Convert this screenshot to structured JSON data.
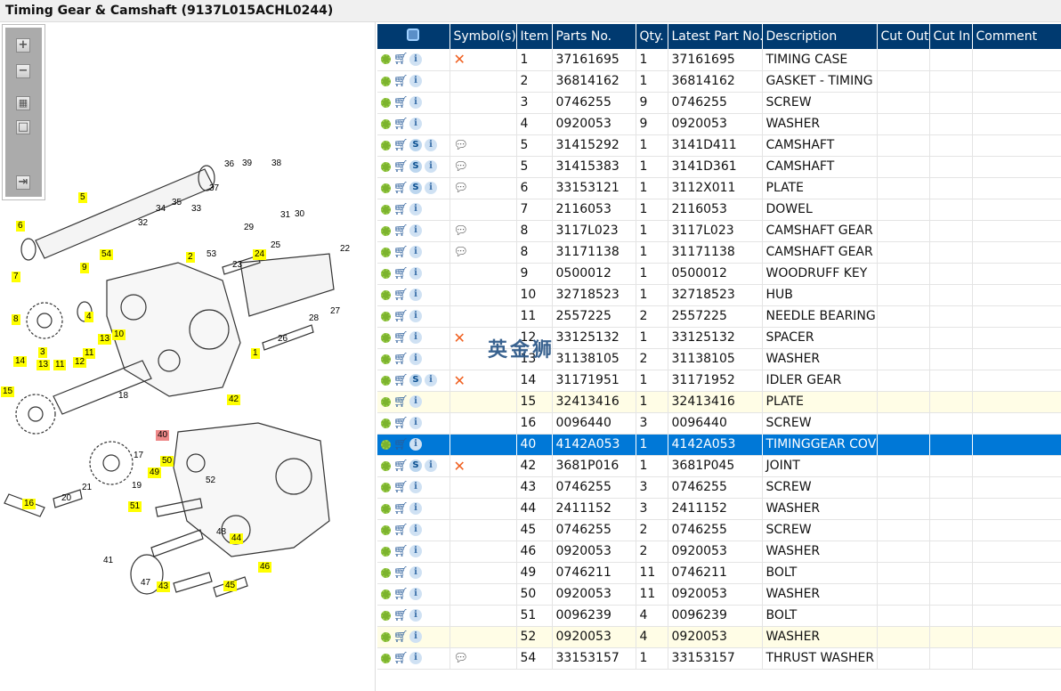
{
  "window": {
    "title": "Timing Gear & Camshaft (9137L015ACHL0244)"
  },
  "toolbar": {
    "zoom_in": "+",
    "zoom_out": "−",
    "fit": "▦",
    "reset": "□",
    "toggle": "⇥"
  },
  "watermark": "英金狮",
  "diagram": {
    "callouts": [
      "36",
      "39",
      "38",
      "5",
      "37",
      "34",
      "35",
      "33",
      "32",
      "6",
      "31",
      "30",
      "29",
      "22",
      "25",
      "24",
      "53",
      "2",
      "23",
      "54",
      "9",
      "7",
      "27",
      "28",
      "26",
      "8",
      "4",
      "3",
      "13",
      "10",
      "1",
      "11",
      "12",
      "14",
      "13",
      "11",
      "18",
      "15",
      "42",
      "40",
      "17",
      "19",
      "16",
      "20",
      "21",
      "49",
      "50",
      "52",
      "51",
      "48",
      "44",
      "41",
      "46",
      "47",
      "43",
      "45"
    ]
  },
  "table": {
    "columns": [
      "Symbol(s)",
      "Item",
      "Parts No.",
      "Qty.",
      "Latest Part No.",
      "Description",
      "Cut Out",
      "Cut In",
      "Comment"
    ],
    "rows": [
      {
        "s": false,
        "sym": "x",
        "item": "1",
        "part": "37161695",
        "qty": "1",
        "latest": "37161695",
        "desc": "TIMING CASE"
      },
      {
        "s": false,
        "sym": "",
        "item": "2",
        "part": "36814162",
        "qty": "1",
        "latest": "36814162",
        "desc": "GASKET - TIMING CASE"
      },
      {
        "s": false,
        "sym": "",
        "item": "3",
        "part": "0746255",
        "qty": "9",
        "latest": "0746255",
        "desc": "SCREW"
      },
      {
        "s": false,
        "sym": "",
        "item": "4",
        "part": "0920053",
        "qty": "9",
        "latest": "0920053",
        "desc": "WASHER"
      },
      {
        "s": true,
        "sym": "note",
        "item": "5",
        "part": "31415292",
        "qty": "1",
        "latest": "3141D411",
        "desc": "CAMSHAFT"
      },
      {
        "s": true,
        "sym": "note",
        "item": "5",
        "part": "31415383",
        "qty": "1",
        "latest": "3141D361",
        "desc": "CAMSHAFT"
      },
      {
        "s": true,
        "sym": "note",
        "item": "6",
        "part": "33153121",
        "qty": "1",
        "latest": "3112X011",
        "desc": "PLATE"
      },
      {
        "s": false,
        "sym": "",
        "item": "7",
        "part": "2116053",
        "qty": "1",
        "latest": "2116053",
        "desc": "DOWEL"
      },
      {
        "s": false,
        "sym": "note",
        "item": "8",
        "part": "3117L023",
        "qty": "1",
        "latest": "3117L023",
        "desc": "CAMSHAFT GEAR"
      },
      {
        "s": false,
        "sym": "note",
        "item": "8",
        "part": "31171138",
        "qty": "1",
        "latest": "31171138",
        "desc": "CAMSHAFT GEAR"
      },
      {
        "s": false,
        "sym": "",
        "item": "9",
        "part": "0500012",
        "qty": "1",
        "latest": "0500012",
        "desc": "WOODRUFF KEY"
      },
      {
        "s": false,
        "sym": "",
        "item": "10",
        "part": "32718523",
        "qty": "1",
        "latest": "32718523",
        "desc": "HUB"
      },
      {
        "s": false,
        "sym": "",
        "item": "11",
        "part": "2557225",
        "qty": "2",
        "latest": "2557225",
        "desc": "NEEDLE BEARING"
      },
      {
        "s": false,
        "sym": "x",
        "item": "12",
        "part": "33125132",
        "qty": "1",
        "latest": "33125132",
        "desc": "SPACER"
      },
      {
        "s": false,
        "sym": "",
        "item": "13",
        "part": "31138105",
        "qty": "2",
        "latest": "31138105",
        "desc": "WASHER"
      },
      {
        "s": true,
        "sym": "x",
        "item": "14",
        "part": "31171951",
        "qty": "1",
        "latest": "31171952",
        "desc": "IDLER GEAR"
      },
      {
        "s": false,
        "sym": "",
        "item": "15",
        "part": "32413416",
        "qty": "1",
        "latest": "32413416",
        "desc": "PLATE",
        "hl": true
      },
      {
        "s": false,
        "sym": "",
        "item": "16",
        "part": "0096440",
        "qty": "3",
        "latest": "0096440",
        "desc": "SCREW"
      },
      {
        "s": false,
        "sym": "",
        "item": "40",
        "part": "4142A053",
        "qty": "1",
        "latest": "4142A053",
        "desc": "TIMINGGEAR COVER",
        "sel": true
      },
      {
        "s": true,
        "sym": "x",
        "item": "42",
        "part": "3681P016",
        "qty": "1",
        "latest": "3681P045",
        "desc": "JOINT"
      },
      {
        "s": false,
        "sym": "",
        "item": "43",
        "part": "0746255",
        "qty": "3",
        "latest": "0746255",
        "desc": "SCREW"
      },
      {
        "s": false,
        "sym": "",
        "item": "44",
        "part": "2411152",
        "qty": "3",
        "latest": "2411152",
        "desc": "WASHER"
      },
      {
        "s": false,
        "sym": "",
        "item": "45",
        "part": "0746255",
        "qty": "2",
        "latest": "0746255",
        "desc": "SCREW"
      },
      {
        "s": false,
        "sym": "",
        "item": "46",
        "part": "0920053",
        "qty": "2",
        "latest": "0920053",
        "desc": "WASHER"
      },
      {
        "s": false,
        "sym": "",
        "item": "49",
        "part": "0746211",
        "qty": "11",
        "latest": "0746211",
        "desc": "BOLT"
      },
      {
        "s": false,
        "sym": "",
        "item": "50",
        "part": "0920053",
        "qty": "11",
        "latest": "0920053",
        "desc": "WASHER"
      },
      {
        "s": false,
        "sym": "",
        "item": "51",
        "part": "0096239",
        "qty": "4",
        "latest": "0096239",
        "desc": "BOLT"
      },
      {
        "s": false,
        "sym": "",
        "item": "52",
        "part": "0920053",
        "qty": "4",
        "latest": "0920053",
        "desc": "WASHER",
        "hl": true
      },
      {
        "s": false,
        "sym": "note",
        "item": "54",
        "part": "33153157",
        "qty": "1",
        "latest": "33153157",
        "desc": "THRUST WASHER"
      }
    ]
  }
}
